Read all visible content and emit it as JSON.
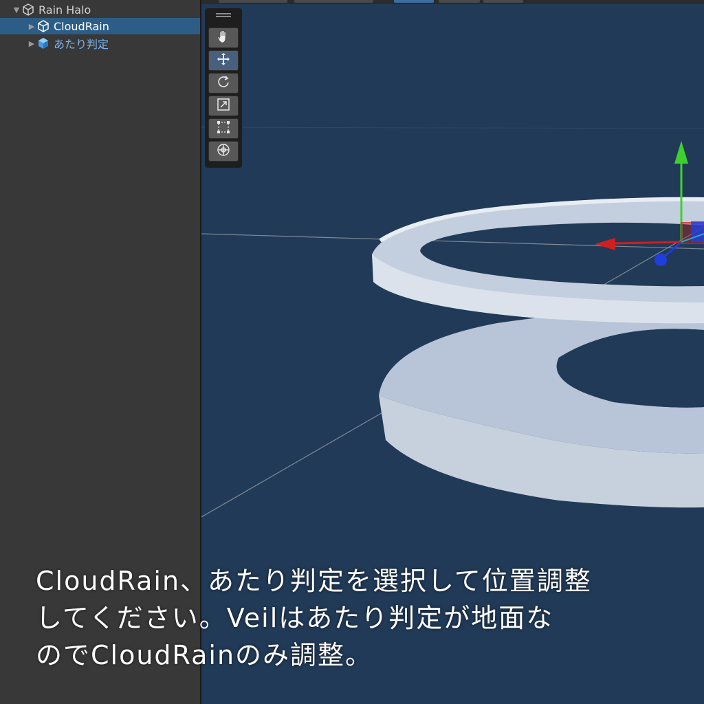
{
  "hierarchy": {
    "items": [
      {
        "label": "Rain Halo",
        "expanded": true,
        "icon": "cube-outline-icon"
      },
      {
        "label": "CloudRain",
        "selected": true,
        "icon": "cube-outline-icon"
      },
      {
        "label": "あたり判定",
        "prefab": true,
        "icon": "prefab-cube-icon"
      }
    ]
  },
  "scene": {
    "background": "#213a57",
    "tools": [
      {
        "name": "hand-tool",
        "icon": "hand-icon",
        "active": false
      },
      {
        "name": "move-tool",
        "icon": "move-arrows-icon",
        "active": true
      },
      {
        "name": "rotate-tool",
        "icon": "rotate-icon",
        "active": false
      },
      {
        "name": "scale-tool",
        "icon": "scale-icon",
        "active": false
      },
      {
        "name": "rect-tool",
        "icon": "rect-transform-icon",
        "active": false
      },
      {
        "name": "transform-tool",
        "icon": "transform-icon",
        "active": false
      }
    ],
    "gizmo": {
      "x_color": "#d21e1e",
      "y_color": "#3ed12e",
      "z_color": "#1f3ee0"
    }
  },
  "caption": {
    "line1": "CloudRain、あたり判定を選択して位置調整",
    "line2": "してください。Veilはあたり判定が地面な",
    "line3": "のでCloudRainのみ調整。"
  }
}
